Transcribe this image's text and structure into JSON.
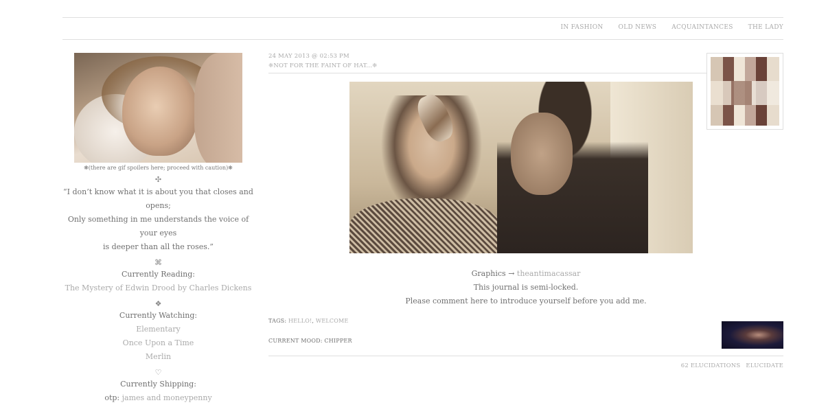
{
  "nav": {
    "items": [
      "IN FASHION",
      "OLD NEWS",
      "ACQUAINTANCES",
      "THE LADY"
    ]
  },
  "sidebar": {
    "caption": "❋(there are gif spoilers here; proceed with caution)❋",
    "ornament1": "✣",
    "quote_line1": "“I don’t know what it is about you that closes and opens;",
    "quote_line2": "Only something in me understands the voice of your eyes",
    "quote_line3": "is deeper than all the roses.”",
    "ornament2": "⌘",
    "reading_head": "Currently Reading:",
    "reading_val": "The Mystery of Edwin Drood by Charles Dickens",
    "ornament3": "❖",
    "watching_head": "Currently Watching:",
    "watching": [
      "Elementary",
      "Once Upon a Time",
      "Merlin"
    ],
    "ornament4": "♡",
    "shipping_head": "Currently Shipping:",
    "ship_label": "otp:",
    "ship_val": "james and moneypenny"
  },
  "post": {
    "date": "24 MAY 2013 @ 02:53 PM",
    "subject": "❈NOT FOR THE FAINT OF HAT...❈",
    "graphics_label": "Graphics →",
    "graphics_credit": "theantimacassar",
    "line2": "This journal is semi-locked.",
    "line3": "Please comment here to introduce yourself before you add me.",
    "tags_label": "TAGS:",
    "tag1": "HELLO!",
    "tag_sep": ",",
    "tag2": "WELCOME",
    "mood": "CURRENT MOOD: CHIPPER",
    "comments": "62 ELUCIDATIONS",
    "reply": "ELUCIDATE"
  }
}
